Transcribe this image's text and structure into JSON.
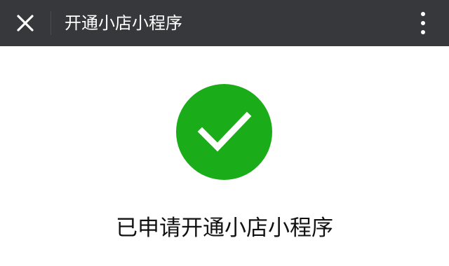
{
  "header": {
    "close_icon": "close-icon",
    "title": "开通小店小程序",
    "more_icon": "more-vertical-icon"
  },
  "result": {
    "icon": "success-check-icon",
    "message": "已申请开通小店小程序"
  },
  "colors": {
    "header_background": "#37383c",
    "success_green": "#1aad19",
    "page_background": "#ffffff",
    "text_dark": "#111111"
  }
}
